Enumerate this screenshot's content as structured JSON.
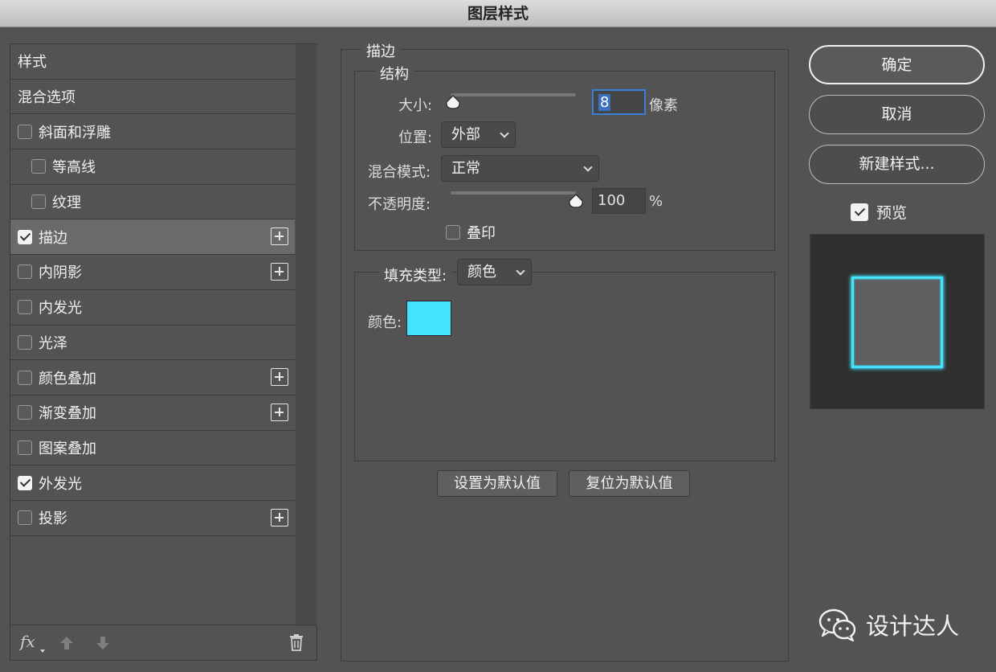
{
  "window": {
    "title": "图层样式"
  },
  "styles_panel": {
    "items": [
      {
        "label": "样式",
        "checkbox": false,
        "checked": false,
        "indent": false,
        "add": false,
        "selected": false
      },
      {
        "label": "混合选项",
        "checkbox": false,
        "checked": false,
        "indent": false,
        "add": false,
        "selected": false
      },
      {
        "label": "斜面和浮雕",
        "checkbox": true,
        "checked": false,
        "indent": false,
        "add": false,
        "selected": false
      },
      {
        "label": "等高线",
        "checkbox": true,
        "checked": false,
        "indent": true,
        "add": false,
        "selected": false
      },
      {
        "label": "纹理",
        "checkbox": true,
        "checked": false,
        "indent": true,
        "add": false,
        "selected": false
      },
      {
        "label": "描边",
        "checkbox": true,
        "checked": true,
        "indent": false,
        "add": true,
        "selected": true
      },
      {
        "label": "内阴影",
        "checkbox": true,
        "checked": false,
        "indent": false,
        "add": true,
        "selected": false
      },
      {
        "label": "内发光",
        "checkbox": true,
        "checked": false,
        "indent": false,
        "add": false,
        "selected": false
      },
      {
        "label": "光泽",
        "checkbox": true,
        "checked": false,
        "indent": false,
        "add": false,
        "selected": false
      },
      {
        "label": "颜色叠加",
        "checkbox": true,
        "checked": false,
        "indent": false,
        "add": true,
        "selected": false
      },
      {
        "label": "渐变叠加",
        "checkbox": true,
        "checked": false,
        "indent": false,
        "add": true,
        "selected": false
      },
      {
        "label": "图案叠加",
        "checkbox": true,
        "checked": false,
        "indent": false,
        "add": false,
        "selected": false
      },
      {
        "label": "外发光",
        "checkbox": true,
        "checked": true,
        "indent": false,
        "add": false,
        "selected": false
      },
      {
        "label": "投影",
        "checkbox": true,
        "checked": false,
        "indent": false,
        "add": true,
        "selected": false
      }
    ],
    "footer": {
      "fx_label": "fx"
    }
  },
  "stroke": {
    "group_title": "描边",
    "structure_title": "结构",
    "size_label": "大小:",
    "size_value": "8",
    "size_unit": "像素",
    "size_fraction": 0.02,
    "position_label": "位置:",
    "position_value": "外部",
    "blend_label": "混合模式:",
    "blend_value": "正常",
    "opacity_label": "不透明度:",
    "opacity_value": "100",
    "opacity_unit": "%",
    "opacity_fraction": 1.0,
    "overprint_label": "叠印",
    "overprint_checked": false,
    "fill_type_label": "填充类型:",
    "fill_type_value": "颜色",
    "color_label": "颜色:",
    "color": "#43e3fd",
    "make_default_label": "设置为默认值",
    "reset_default_label": "复位为默认值"
  },
  "actions": {
    "ok_label": "确定",
    "cancel_label": "取消",
    "new_style_label": "新建样式...",
    "preview_label": "预览",
    "preview_checked": true
  },
  "watermark": {
    "text": "设计达人"
  }
}
